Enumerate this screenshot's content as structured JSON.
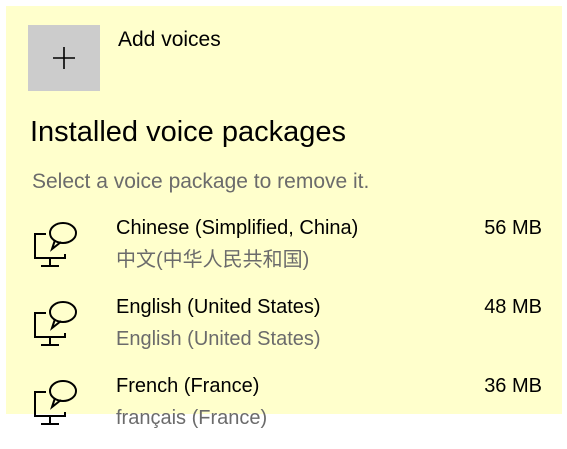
{
  "add_voices": {
    "label": "Add voices",
    "icon": "plus-icon"
  },
  "installed": {
    "title": "Installed voice packages",
    "hint": "Select a voice package to remove it."
  },
  "voices": [
    {
      "name": "Chinese (Simplified, China)",
      "native": "中文(中华人民共和国)",
      "size": "56 MB",
      "icon": "speech-computer-icon"
    },
    {
      "name": "English (United States)",
      "native": "English (United States)",
      "size": "48 MB",
      "icon": "speech-computer-icon"
    },
    {
      "name": "French (France)",
      "native": "français (France)",
      "size": "36 MB",
      "icon": "speech-computer-icon"
    }
  ],
  "colors": {
    "panel_background": "#ffffcc",
    "tile_background": "#cccccc",
    "secondary_text": "#6b6b6b"
  }
}
